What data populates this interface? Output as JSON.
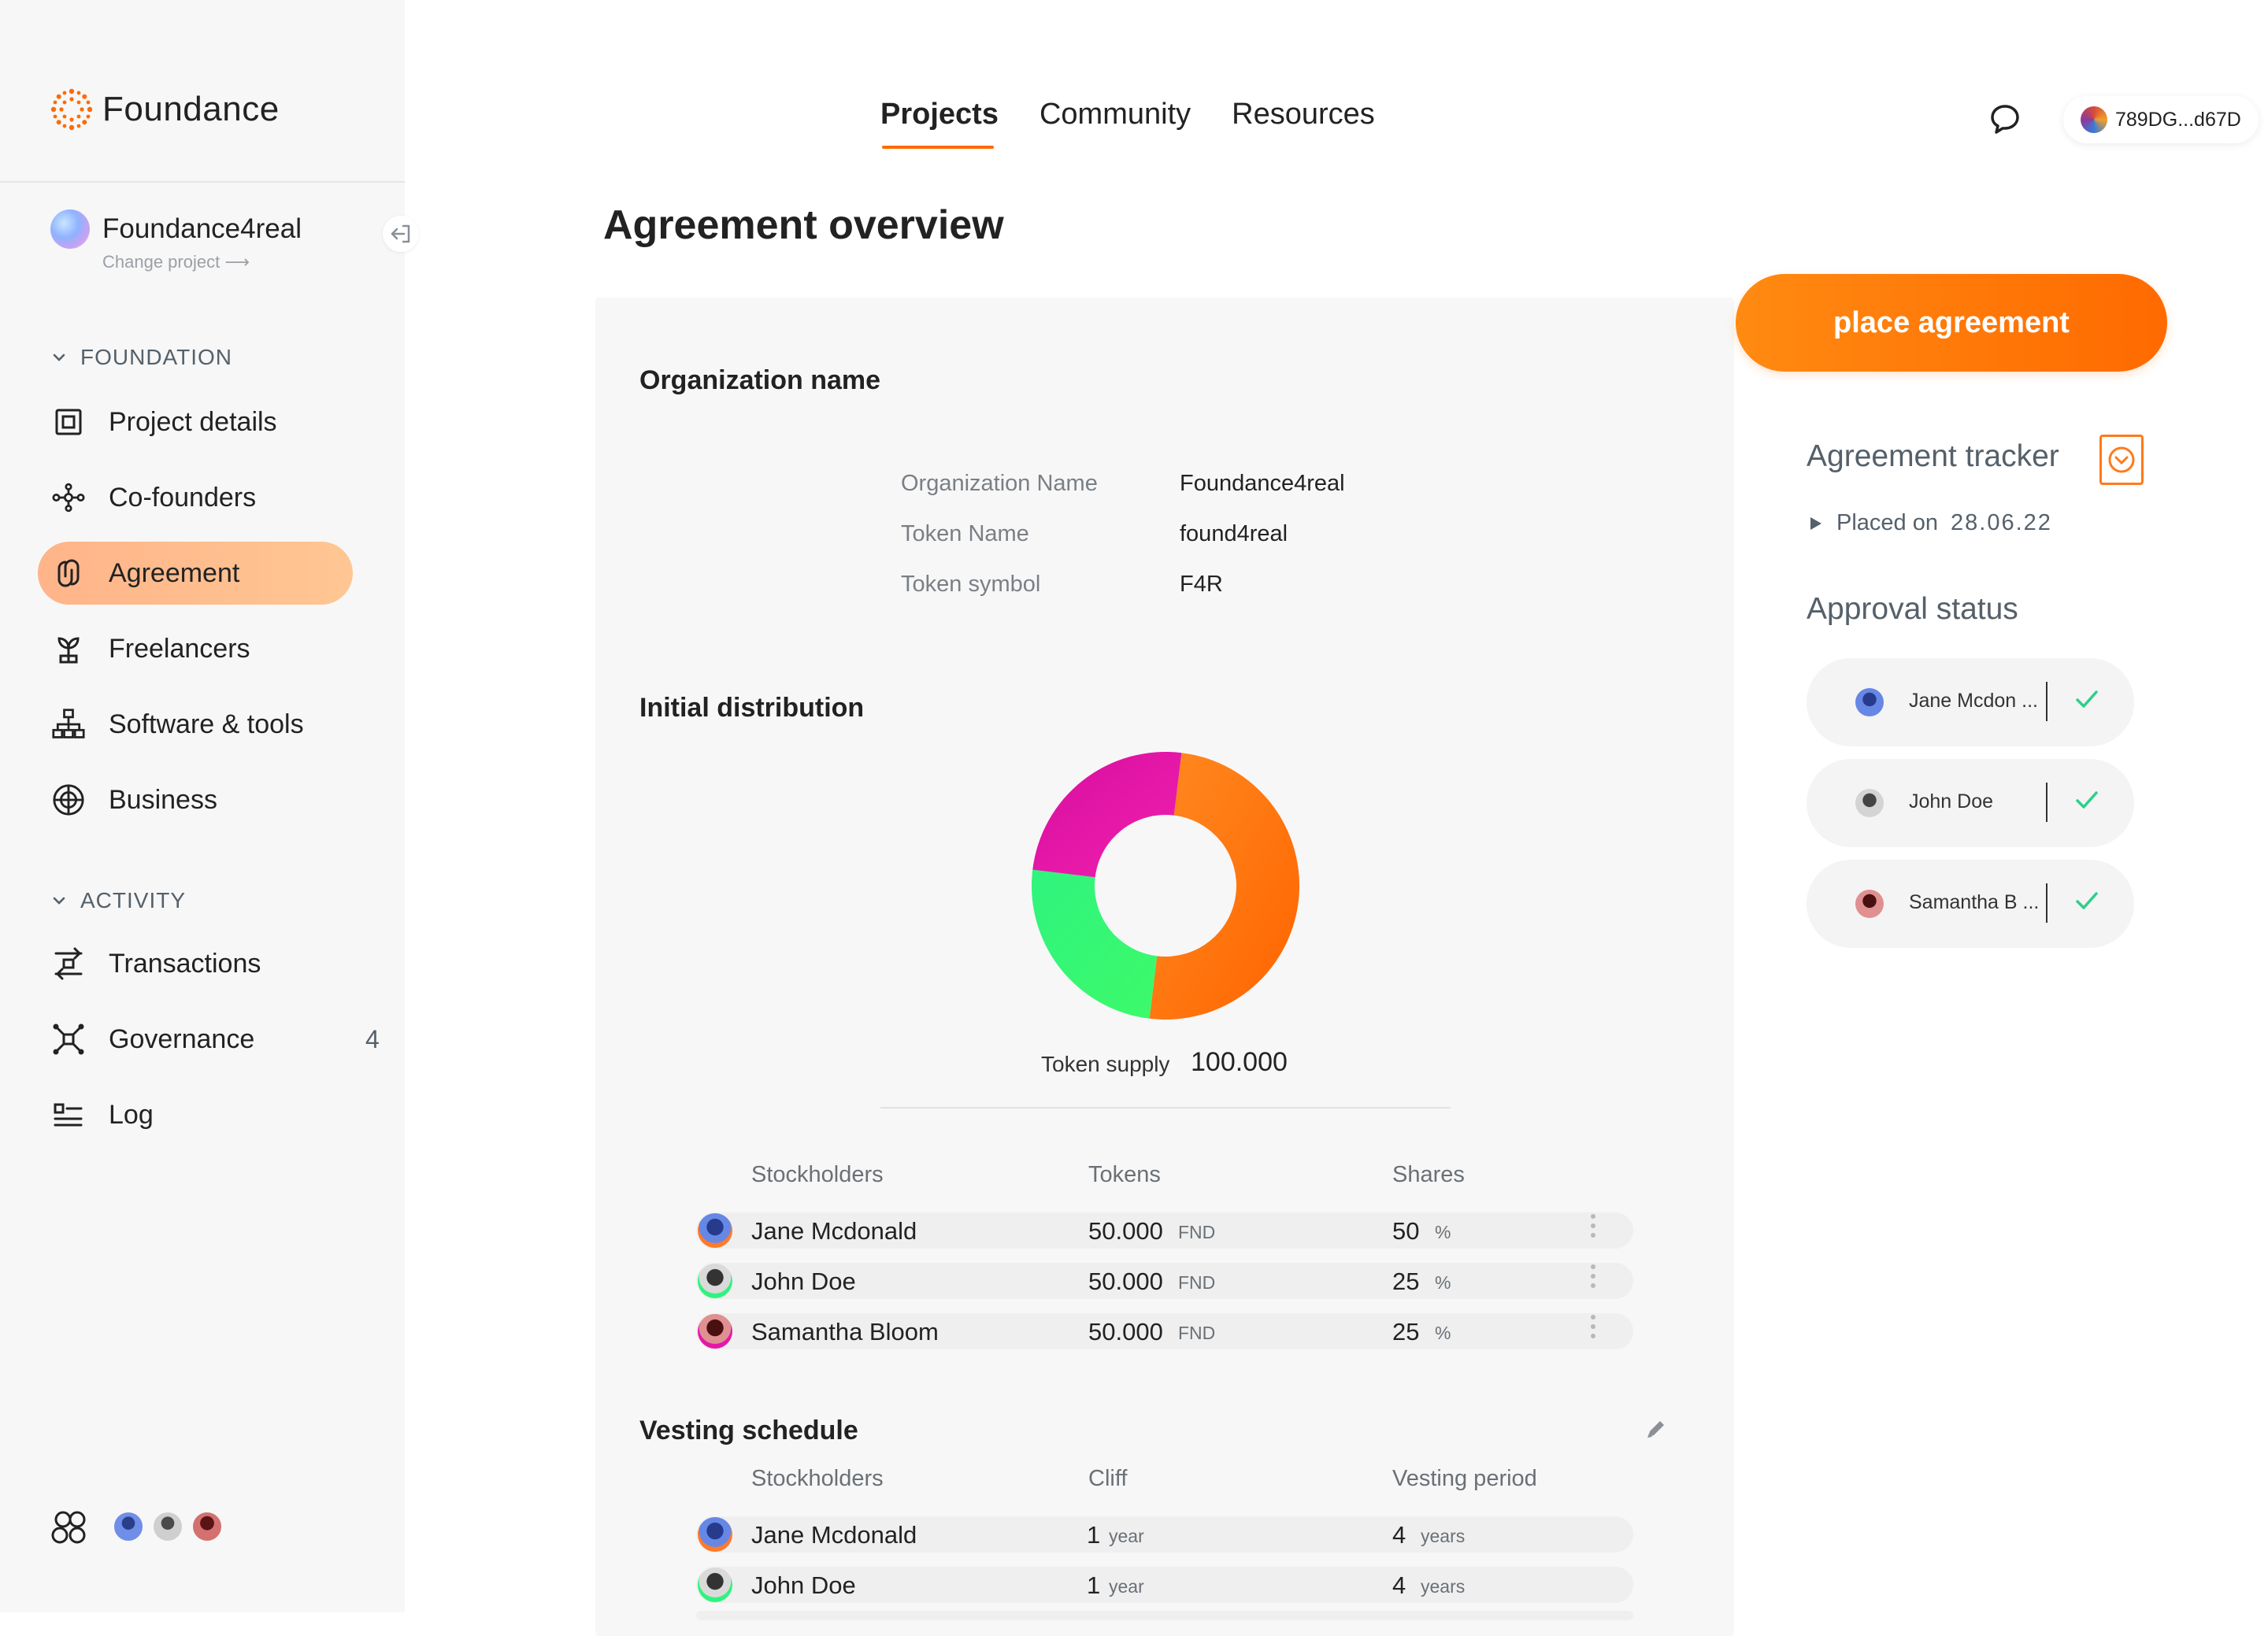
{
  "brand": {
    "name": "Foundance",
    "accent": "#ff6b00"
  },
  "project": {
    "name": "Foundance4real",
    "change_label": "Change project ⟶"
  },
  "sidebar": {
    "sections": [
      {
        "title": "FOUNDATION",
        "items": [
          {
            "label": "Project details",
            "icon": "square-frame-icon"
          },
          {
            "label": "Co-founders",
            "icon": "network-icon"
          },
          {
            "label": "Agreement",
            "icon": "link-icon",
            "active": true
          },
          {
            "label": "Freelancers",
            "icon": "sprout-icon"
          },
          {
            "label": "Software & tools",
            "icon": "hierarchy-icon"
          },
          {
            "label": "Business",
            "icon": "globe-icon"
          }
        ]
      },
      {
        "title": "ACTIVITY",
        "items": [
          {
            "label": "Transactions",
            "icon": "transfer-icon"
          },
          {
            "label": "Governance",
            "icon": "governance-icon",
            "badge": "4"
          },
          {
            "label": "Log",
            "icon": "log-icon"
          }
        ]
      }
    ]
  },
  "topnav": {
    "items": [
      "Projects",
      "Community",
      "Resources"
    ],
    "active": "Projects"
  },
  "wallet": {
    "address": "789DG...d67D"
  },
  "page": {
    "title": "Agreement overview"
  },
  "organization": {
    "heading": "Organization name",
    "fields": [
      {
        "label": "Organization Name",
        "value": "Foundance4real"
      },
      {
        "label": "Token Name",
        "value": "found4real"
      },
      {
        "label": "Token symbol",
        "value": "F4R"
      }
    ]
  },
  "distribution": {
    "heading": "Initial distribution",
    "supply_label": "Token supply",
    "supply_value": "100.000",
    "columns": [
      "Stockholders",
      "Tokens",
      "Shares"
    ],
    "rows": [
      {
        "name": "Jane Mcdonald",
        "tokens": "50.000",
        "token_unit": "FND",
        "shares": "50",
        "share_unit": "%"
      },
      {
        "name": "John Doe",
        "tokens": "50.000",
        "token_unit": "FND",
        "shares": "25",
        "share_unit": "%"
      },
      {
        "name": "Samantha Bloom",
        "tokens": "50.000",
        "token_unit": "FND",
        "shares": "25",
        "share_unit": "%"
      }
    ]
  },
  "chart_data": {
    "type": "pie",
    "categories": [
      "Jane Mcdonald",
      "John Doe",
      "Samantha Bloom"
    ],
    "values": [
      50,
      25,
      25
    ],
    "colors": [
      "#ff6e0a",
      "#2dfa7d",
      "#e318a8"
    ],
    "donut": true
  },
  "vesting": {
    "heading": "Vesting schedule",
    "columns": [
      "Stockholders",
      "Cliff",
      "Vesting period"
    ],
    "rows": [
      {
        "name": "Jane Mcdonald",
        "cliff": "1",
        "cliff_unit": "year",
        "period": "4",
        "period_unit": "years"
      },
      {
        "name": "John Doe",
        "cliff": "1",
        "cliff_unit": "year",
        "period": "4",
        "period_unit": "years"
      }
    ]
  },
  "actions": {
    "place_agreement": "place agreement"
  },
  "tracker": {
    "title": "Agreement tracker",
    "placed_label": "Placed on",
    "placed_date": "28.06.22"
  },
  "approval": {
    "title": "Approval status",
    "items": [
      {
        "name": "Jane Mcdon ..."
      },
      {
        "name": "John Doe"
      },
      {
        "name": "Samantha B ..."
      }
    ]
  }
}
